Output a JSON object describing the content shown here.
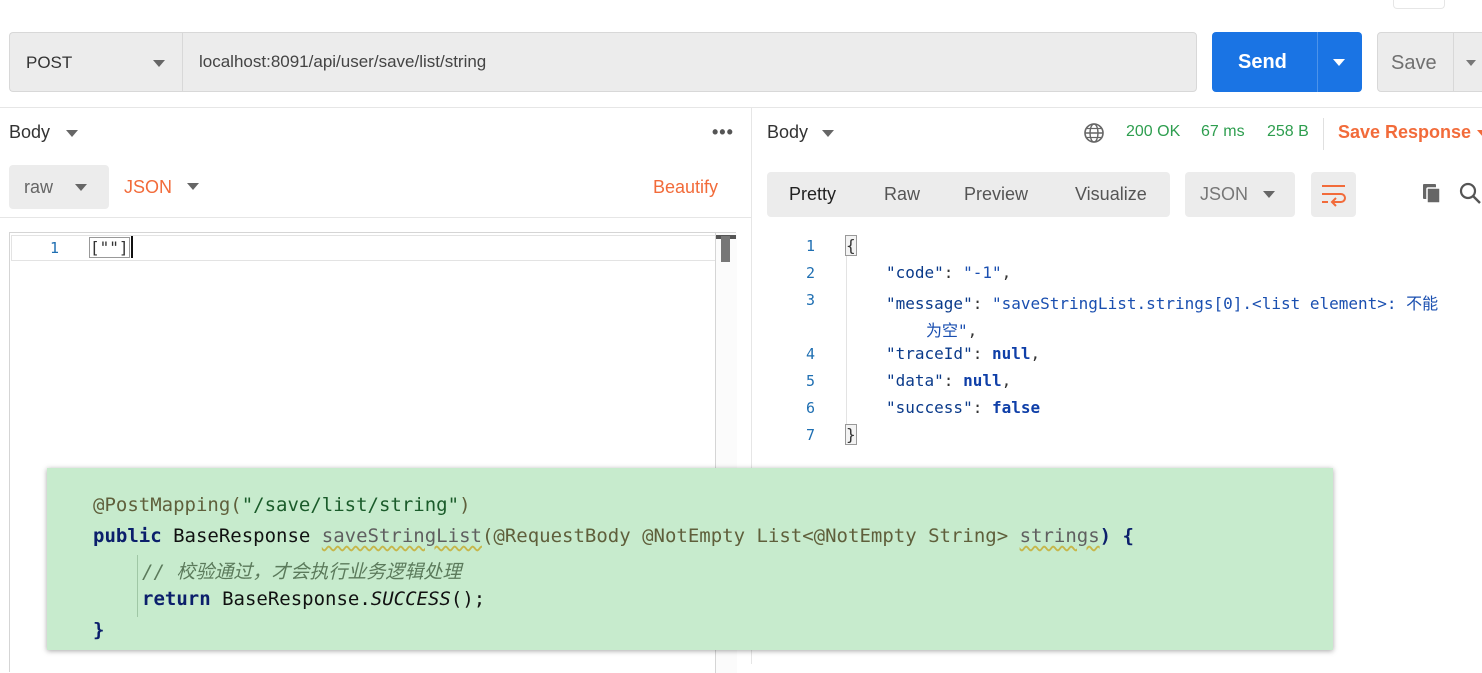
{
  "request": {
    "method": "POST",
    "url": "localhost:8091/api/user/save/list/string",
    "send_label": "Send",
    "save_label": "Save"
  },
  "left_pane": {
    "body_label": "Body",
    "more": "•••",
    "body_type": "raw",
    "format": "JSON",
    "beautify": "Beautify",
    "editor_lines": [
      {
        "num": "1",
        "text": "[\"\"]"
      }
    ]
  },
  "right_pane": {
    "body_label": "Body",
    "status": "200 OK",
    "time": "67 ms",
    "size": "258 B",
    "save_response": "Save Response",
    "tabs": [
      "Pretty",
      "Raw",
      "Preview",
      "Visualize"
    ],
    "format": "JSON",
    "line_numbers": [
      "1",
      "2",
      "3",
      "4",
      "5",
      "6",
      "7"
    ],
    "response": {
      "open": "{",
      "code_key": "\"code\"",
      "code_val": "\"-1\"",
      "message_key": "\"message\"",
      "message_val_1": "\"saveStringList.strings[0].<list element>: 不能",
      "message_val_2": "为空\"",
      "traceId_key": "\"traceId\"",
      "traceId_val": "null",
      "data_key": "\"data\"",
      "data_val": "null",
      "success_key": "\"success\"",
      "success_val": "false",
      "close": "}"
    }
  },
  "overlay": {
    "line1_ann": "@PostMapping(",
    "line1_str": "\"/save/list/string\"",
    "line1_end": ")",
    "line2_public": "public",
    "line2_type": " BaseResponse ",
    "line2_method": "saveStringList",
    "line2_params_a": "(@RequestBody @NotEmpty List<@NotEmpty String> ",
    "line2_param": "strings",
    "line2_end": ") {",
    "line3_comment": "// 校验通过，才会执行业务逻辑处理",
    "line4_return": "return",
    "line4_mid": " BaseResponse.",
    "line4_const": "SUCCESS",
    "line4_end": "();",
    "line5": "}"
  },
  "colors": {
    "send_blue": "#1a74e4",
    "accent_orange": "#f26b3a",
    "status_green": "#2e9e4f",
    "overlay_green": "#c7ebcd"
  }
}
